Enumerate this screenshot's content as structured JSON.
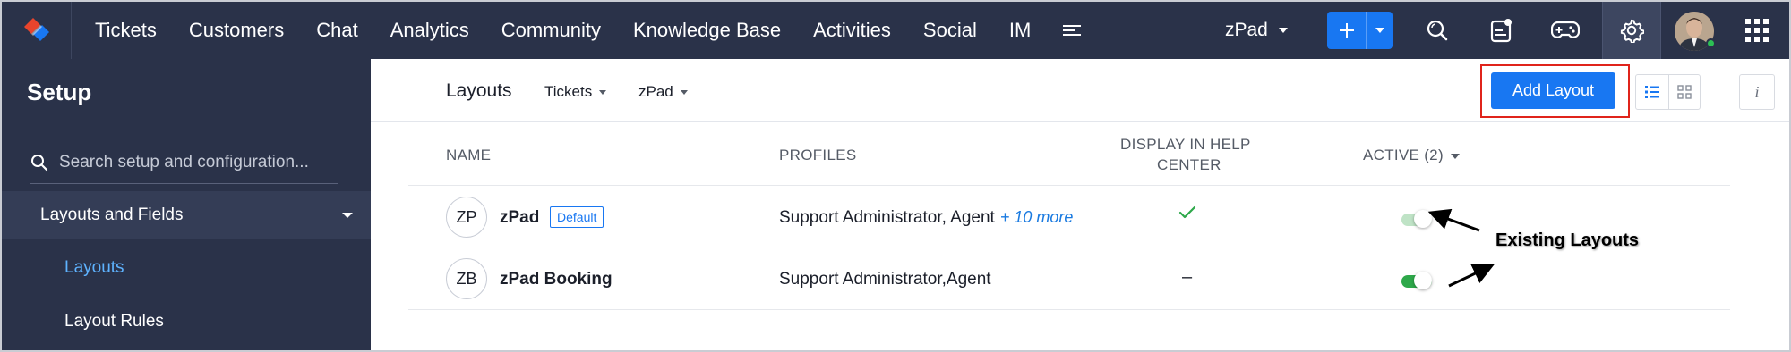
{
  "topbar": {
    "nav": [
      "Tickets",
      "Customers",
      "Chat",
      "Analytics",
      "Community",
      "Knowledge Base",
      "Activities",
      "Social",
      "IM"
    ],
    "portal": "zPad"
  },
  "sidebar": {
    "title": "Setup",
    "search_placeholder": "Search setup and configuration...",
    "group": "Layouts and Fields",
    "items": [
      {
        "label": "Layouts",
        "active": true
      },
      {
        "label": "Layout Rules",
        "active": false
      }
    ]
  },
  "main": {
    "title": "Layouts",
    "filters": [
      "Tickets",
      "zPad"
    ],
    "add_button": "Add Layout",
    "info_label": "i"
  },
  "table": {
    "columns": [
      "NAME",
      "PROFILES",
      "DISPLAY IN HELP",
      "CENTER",
      "ACTIVE (2)"
    ],
    "rows": [
      {
        "initials": "ZP",
        "name": "zPad",
        "tag": "Default",
        "profiles": "Support Administrator, Agent",
        "more": "+ 10 more",
        "help_center": "✓",
        "active": false
      },
      {
        "initials": "ZB",
        "name": "zPad Booking",
        "tag": "",
        "profiles": "Support Administrator,Agent",
        "more": "",
        "help_center": "–",
        "active": true
      }
    ]
  },
  "annotation": "Existing Layouts",
  "colors": {
    "nav_bg": "#2a3249",
    "accent": "#1877f2",
    "active_link": "#5eb3ff",
    "toggle_on": "#2ea84a",
    "toggle_off": "#bfe3c6",
    "highlight": "#e0241b"
  }
}
